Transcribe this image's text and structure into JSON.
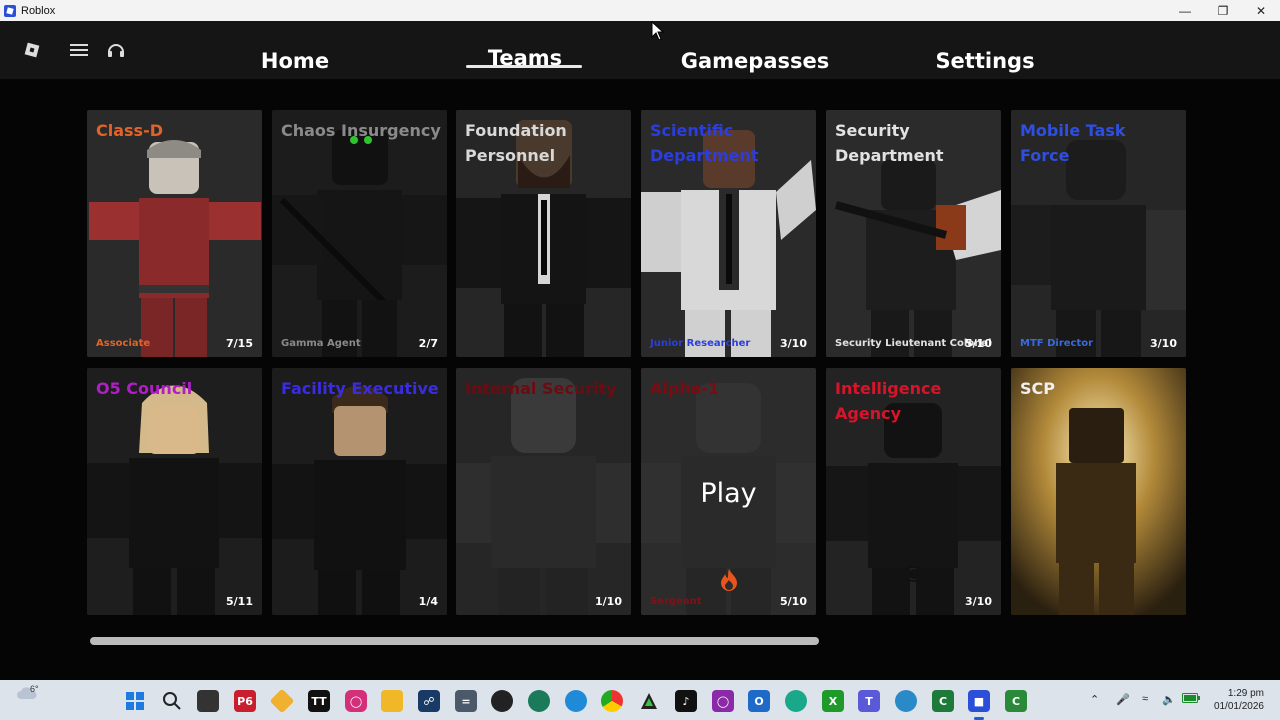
{
  "window": {
    "title": "Roblox"
  },
  "titlebar": {
    "minimize_icon": "minimize-icon",
    "restore_icon": "restore-icon",
    "close_icon": "close-icon"
  },
  "nav": {
    "icons": [
      "roblox-logo-icon",
      "menu-icon",
      "headset-icon"
    ],
    "tabs": [
      {
        "label": "Home",
        "active": false
      },
      {
        "label": "Teams",
        "active": true
      },
      {
        "label": "Gamepasses",
        "active": false
      },
      {
        "label": "Settings",
        "active": false
      }
    ]
  },
  "teams": [
    {
      "name": "Class-D",
      "color": "#e0642a",
      "rank": "Associate",
      "rank_color": "#e0642a",
      "count": "7/15"
    },
    {
      "name": "Chaos Insurgency",
      "color": "#8a8a8a",
      "rank": "Gamma Agent",
      "rank_color": "#8a8a8a",
      "count": "2/7"
    },
    {
      "name": "Foundation Personnel",
      "color": "#d8d8d8",
      "rank": "",
      "rank_color": "#d8d8d8",
      "count": ""
    },
    {
      "name": "Scientific Department",
      "color": "#2a3ee0",
      "rank": "Junior Researcher",
      "rank_color": "#2a3ee0",
      "count": "3/10"
    },
    {
      "name": "Security Department",
      "color": "#e2e2e2",
      "rank": "Security Lieutenant Colonel",
      "rank_color": "#e2e2e2",
      "count": "5/10"
    },
    {
      "name": "Mobile Task Force",
      "color": "#2e4fe0",
      "rank": "MTF Director",
      "rank_color": "#3a6ae0",
      "count": "3/10"
    },
    {
      "name": "O5 Council",
      "color": "#b01fc4",
      "rank": "",
      "rank_color": "#b01fc4",
      "count": "5/11"
    },
    {
      "name": "Facility Executive",
      "color": "#3a2ce0",
      "rank": "",
      "rank_color": "#3a2ce0",
      "count": "1/4"
    },
    {
      "name": "Internal Security",
      "color": "#6b0c12",
      "rank": "",
      "rank_color": "#6b0c12",
      "count": "1/10"
    },
    {
      "name": "Alpha-1",
      "color": "#7a0c12",
      "rank": "Sergeant",
      "rank_color": "#8a0d14",
      "count": "5/10",
      "overlay": "Play"
    },
    {
      "name": "Intelligence Agency",
      "color": "#d8142a",
      "rank": "",
      "rank_color": "#d8142a",
      "count": "3/10"
    },
    {
      "name": "SCP",
      "color": "#f0f0f0",
      "rank": "",
      "rank_color": "#f0f0f0",
      "count": ""
    }
  ],
  "scrollbar": {
    "position": 0.0
  },
  "taskbar": {
    "weather": "6°",
    "time": "1:29 pm",
    "date": "01/01/2026",
    "apps": [
      "start-icon",
      "search-icon",
      "file-manager-icon",
      "photoshop-icon",
      "sketch-icon",
      "tiktok-studio-icon",
      "instagram-icon",
      "folder-icon",
      "vpn-icon",
      "calculator-icon",
      "obs-icon",
      "clipchamp-icon",
      "edge-icon",
      "chrome-icon",
      "capcut-icon",
      "tiktok-icon",
      "instagram-alt-icon",
      "outlook-icon",
      "spotify-icon",
      "xbox-icon",
      "teams-icon",
      "discord-icon",
      "excel-icon",
      "roblox-icon",
      "camtasia-icon"
    ]
  }
}
